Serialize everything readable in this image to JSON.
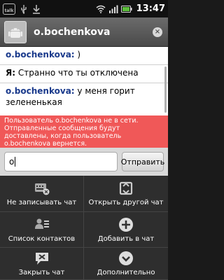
{
  "status_bar": {
    "talk_label": "talk",
    "time": "13:47"
  },
  "header": {
    "title": "o.bochenkova"
  },
  "messages": [
    {
      "sender": "o.bochenkova:",
      "text": " )"
    },
    {
      "sender": "Я:",
      "text": " Странно что ты отключена"
    },
    {
      "sender": "o.bochenkova:",
      "text": " у меня горит зелененькая"
    }
  ],
  "warning": {
    "text": "Пользователь o.bochenkova не в сети. Отправленные сообщения будут доставлены, когда пользователь o.bochenkova вернется."
  },
  "compose": {
    "value": "о",
    "send_label": "Отправить"
  },
  "menu": {
    "items": [
      {
        "label": "Не записывать чат",
        "icon": "record-off-icon"
      },
      {
        "label": "Открыть другой чат",
        "icon": "switch-chat-icon"
      },
      {
        "label": "Список контактов",
        "icon": "contacts-icon"
      },
      {
        "label": "Добавить в чат",
        "icon": "add-icon"
      },
      {
        "label": "Закрыть чат",
        "icon": "close-chat-icon"
      },
      {
        "label": "Дополнительно",
        "icon": "more-icon"
      }
    ]
  },
  "colors": {
    "warning_bg": "#f05858",
    "sender_color": "#1a3a8c",
    "menu_bg": "#2e2e2e"
  }
}
